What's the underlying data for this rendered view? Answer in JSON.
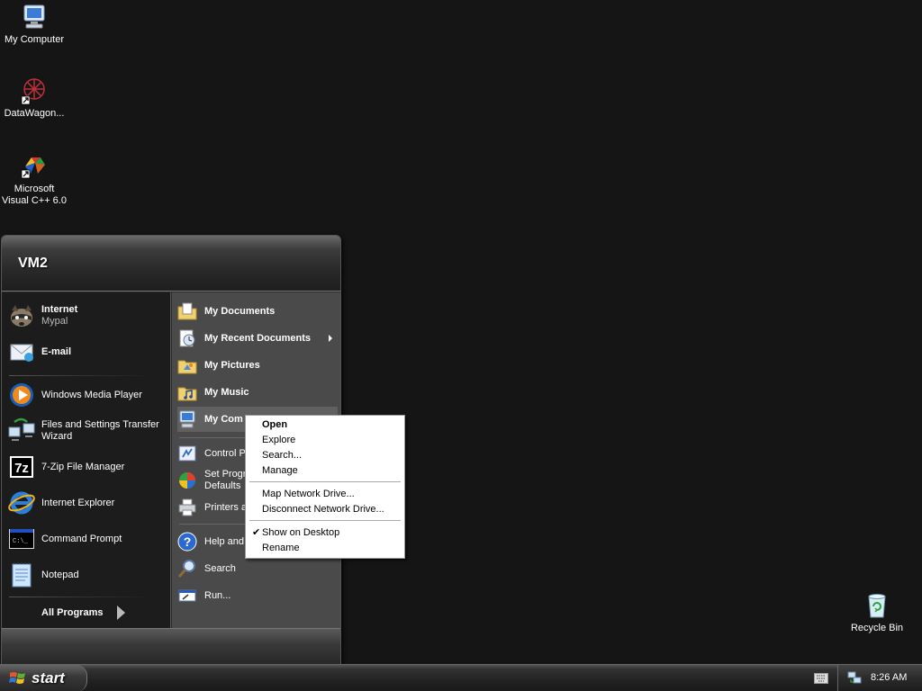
{
  "desktop": {
    "icons": [
      {
        "label": "My Computer",
        "icon": "my-computer-icon"
      },
      {
        "label": "DataWagon...",
        "icon": "datawagon-shortcut-icon"
      },
      {
        "label": "Microsoft Visual C++ 6.0",
        "icon": "visual-cpp-shortcut-icon"
      },
      {
        "label": "Recycle Bin",
        "icon": "recycle-bin-icon"
      }
    ]
  },
  "start_menu": {
    "user_name": "VM2",
    "pinned": [
      {
        "title": "Internet",
        "subtitle": "Mypal",
        "icon": "raccoon-browser-icon"
      },
      {
        "title": "E-mail",
        "icon": "email-icon"
      }
    ],
    "recent": [
      {
        "title": "Windows Media Player",
        "icon": "media-player-icon"
      },
      {
        "title": "Files and Settings Transfer Wizard",
        "icon": "transfer-wizard-icon"
      },
      {
        "title": "7-Zip File Manager",
        "icon": "seven-zip-icon"
      },
      {
        "title": "Internet Explorer",
        "icon": "internet-explorer-icon"
      },
      {
        "title": "Command Prompt",
        "icon": "command-prompt-icon"
      },
      {
        "title": "Notepad",
        "icon": "notepad-icon"
      }
    ],
    "all_programs_label": "All Programs",
    "places": [
      {
        "label": "My Documents",
        "icon": "my-documents-icon"
      },
      {
        "label": "My Recent Documents",
        "icon": "recent-documents-icon"
      },
      {
        "label": "My Pictures",
        "icon": "my-pictures-icon"
      },
      {
        "label": "My Music",
        "icon": "my-music-icon"
      },
      {
        "label": "My Com",
        "icon": "my-computer-icon"
      }
    ],
    "system": [
      {
        "label": "Control Pa",
        "icon": "control-panel-icon"
      },
      {
        "label": "Set Progr",
        "label2": "Defaults",
        "icon": "set-program-defaults-icon"
      },
      {
        "label": "Printers a",
        "icon": "printer-icon"
      }
    ],
    "tools": [
      {
        "label": "Help and",
        "icon": "help-icon"
      },
      {
        "label": "Search",
        "icon": "search-icon"
      },
      {
        "label": "Run...",
        "icon": "run-icon"
      }
    ]
  },
  "context_menu": {
    "items": [
      {
        "label": "Open"
      },
      {
        "label": "Explore"
      },
      {
        "label": "Search..."
      },
      {
        "label": "Manage"
      },
      {
        "label": "Map Network Drive..."
      },
      {
        "label": "Disconnect Network Drive..."
      },
      {
        "label": "Show on Desktop",
        "check": "✔"
      },
      {
        "label": "Rename"
      }
    ]
  },
  "taskbar": {
    "start_label": "start",
    "clock": "8:26 AM"
  }
}
